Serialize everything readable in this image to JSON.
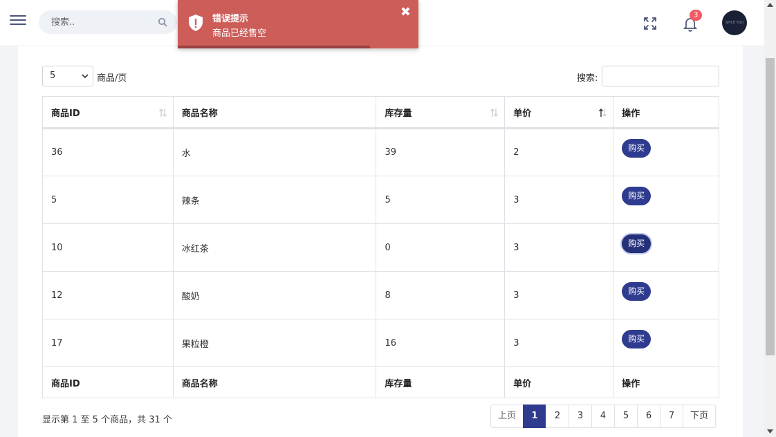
{
  "header": {
    "search_placeholder": "搜索..",
    "notification_count": "3",
    "avatar_text": "SPICE YOU"
  },
  "toast": {
    "title": "错误提示",
    "message": "商品已经售空",
    "close_symbol": "✖",
    "progress": 0.8,
    "color": "#cc5d59"
  },
  "controls": {
    "page_length": "5",
    "page_length_label": "商品/页",
    "filter_label": "搜索:",
    "filter_value": ""
  },
  "table": {
    "columns": [
      "商品ID",
      "商品名称",
      "库存量",
      "单价",
      "操作"
    ],
    "rows": [
      {
        "id": "36",
        "name": "水",
        "stock": "39",
        "price": "2",
        "action": "购买"
      },
      {
        "id": "5",
        "name": "辣条",
        "stock": "5",
        "price": "3",
        "action": "购买"
      },
      {
        "id": "10",
        "name": "冰红茶",
        "stock": "0",
        "price": "3",
        "action": "购买"
      },
      {
        "id": "12",
        "name": "酸奶",
        "stock": "8",
        "price": "3",
        "action": "购买"
      },
      {
        "id": "17",
        "name": "果粒橙",
        "stock": "16",
        "price": "3",
        "action": "购买"
      }
    ]
  },
  "footer": {
    "info": "显示第 1 至 5 个商品，共 31 个",
    "prev": "上页",
    "pages": [
      "1",
      "2",
      "3",
      "4",
      "5",
      "6",
      "7"
    ],
    "next": "下页",
    "current_page": "1"
  },
  "colors": {
    "primary": "#2e3b8f",
    "badge": "#f25961"
  }
}
